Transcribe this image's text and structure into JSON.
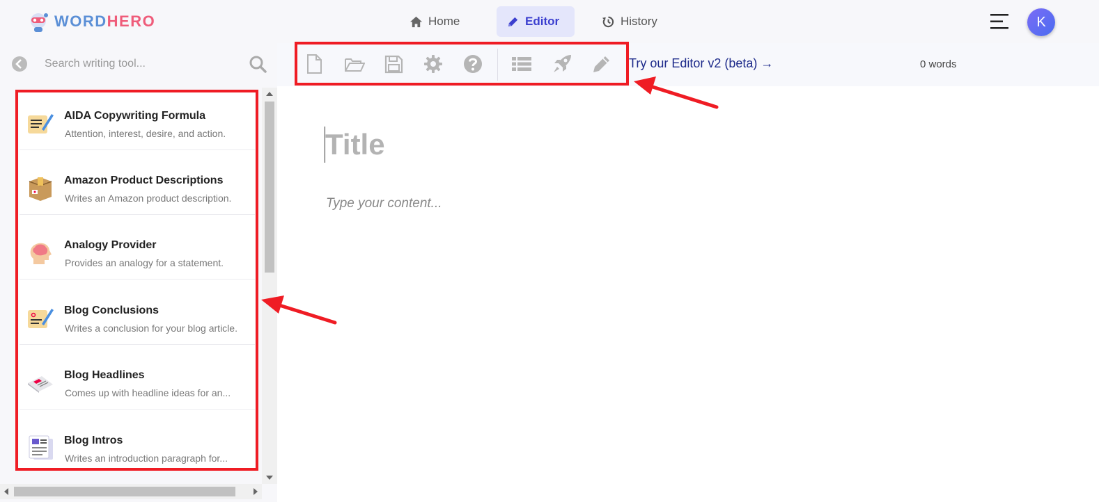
{
  "app": {
    "logo_part1": "WORD",
    "logo_part2": "HERO",
    "brand_blue": "#5b8fd6",
    "brand_pink": "#ef5c7a"
  },
  "nav": {
    "home": {
      "label": "Home",
      "icon": "home-icon"
    },
    "editor": {
      "label": "Editor",
      "icon": "pencil-icon",
      "active": true
    },
    "history": {
      "label": "History",
      "icon": "history-icon"
    }
  },
  "user": {
    "avatar_initial": "K"
  },
  "sidebar": {
    "search_placeholder": "Search writing tool...",
    "tools": [
      {
        "title": "AIDA Copywriting Formula",
        "desc": "Attention, interest, desire, and action.",
        "icon": "memo-pen-icon"
      },
      {
        "title": "Amazon Product Descriptions",
        "desc": "Writes an Amazon product description.",
        "icon": "package-box-icon"
      },
      {
        "title": "Analogy Provider",
        "desc": "Provides an analogy for a statement.",
        "icon": "brain-head-icon"
      },
      {
        "title": "Blog Conclusions",
        "desc": "Writes a conclusion for your blog article.",
        "icon": "memo-pen-icon"
      },
      {
        "title": "Blog Headlines",
        "desc": "Comes up with headline ideas for an...",
        "icon": "newspaper-icon"
      },
      {
        "title": "Blog Intros",
        "desc": "Writes an introduction paragraph for...",
        "icon": "document-stack-icon"
      }
    ]
  },
  "toolbar": {
    "buttons": [
      "new-file-icon",
      "open-folder-icon",
      "save-icon",
      "settings-gear-icon",
      "help-icon",
      "list-icon",
      "rocket-icon",
      "pencil-icon"
    ],
    "beta_link": "Try our Editor v2 (beta) →",
    "word_count": "0 words"
  },
  "editor": {
    "title_placeholder": "Title",
    "content_placeholder": "Type your content..."
  },
  "annotation_color": "#ef1c24"
}
